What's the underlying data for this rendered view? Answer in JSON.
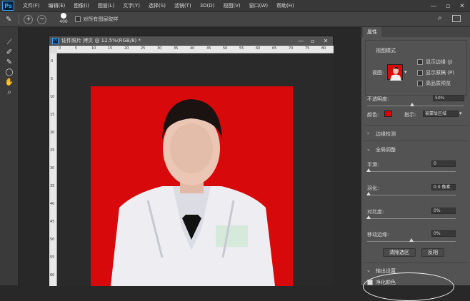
{
  "app": {
    "logo": "Ps"
  },
  "menu": [
    "文件(F)",
    "编辑(E)",
    "图像(I)",
    "图层(L)",
    "文字(Y)",
    "选择(S)",
    "滤镜(T)",
    "3D(D)",
    "视图(V)",
    "窗口(W)",
    "帮助(H)"
  ],
  "options_bar": {
    "brush_size": "400",
    "sample_all_layers": "对所有图层取样"
  },
  "document": {
    "title": "证件照片 拷贝 @ 12.5%(RGB/8) *",
    "ruler_h": [
      "0",
      "5",
      "10",
      "15",
      "20",
      "25",
      "30",
      "35",
      "40",
      "45",
      "50",
      "55",
      "60",
      "65",
      "70",
      "75",
      "80"
    ],
    "ruler_v": [
      "0",
      "5",
      "10",
      "15",
      "20",
      "25",
      "30",
      "35",
      "40",
      "45",
      "50",
      "55",
      "60"
    ]
  },
  "properties": {
    "tab": "属性",
    "view_mode_label": "视图模式",
    "view_label": "视图:",
    "show_edge": "显示边缘 (J)",
    "show_original": "显示原稿 (P)",
    "hq_preview": "高品质预览",
    "opacity_label": "不透明度:",
    "opacity_value": "50%",
    "color_label": "颜色:",
    "color_value": "#e00000",
    "indicate_label": "指示:",
    "indicate_value": "被蒙版区域",
    "edge_detect": "边缘检测",
    "global_refine": "全局调整",
    "smooth_label": "平滑:",
    "smooth_value": "0",
    "feather_label": "羽化:",
    "feather_value": "0.0 像素",
    "contrast_label": "对比度:",
    "contrast_value": "0%",
    "shift_edge_label": "移动边缘:",
    "shift_edge_value": "0%",
    "clear_selection": "清除选区",
    "invert": "反相",
    "output_settings": "输出设置",
    "decontaminate": "净化颜色"
  }
}
